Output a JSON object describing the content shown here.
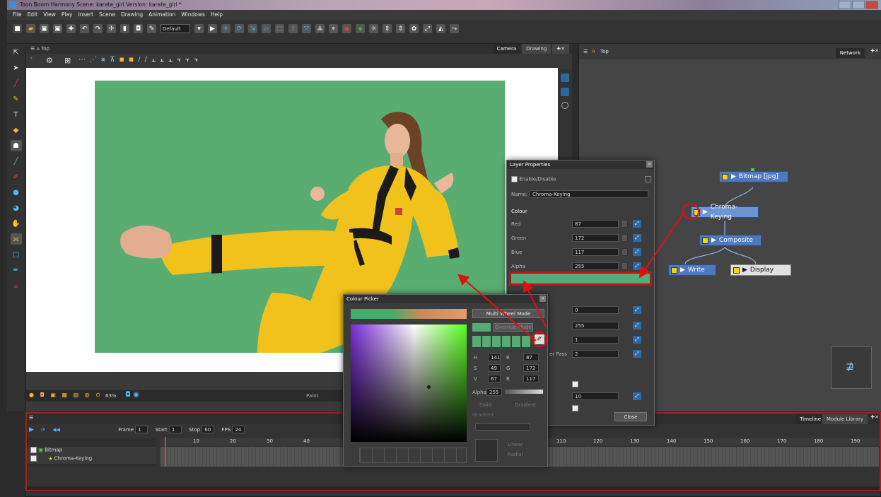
{
  "window": {
    "title": "Toon Boom Harmony Scene: karate_girl Version: karate_girl *"
  },
  "menu": [
    "File",
    "Edit",
    "View",
    "Play",
    "Insert",
    "Scene",
    "Drawing",
    "Animation",
    "Windows",
    "Help"
  ],
  "toolbar": {
    "preset_select": "Default"
  },
  "camera_view": {
    "header": "Top",
    "tabs": [
      "Camera",
      "Drawing"
    ],
    "bottom_zoom": "63%",
    "bottom_label": "Paint"
  },
  "node_view": {
    "header": "Top",
    "tab": "Network",
    "nodes": [
      {
        "label": "Bitmap [jpg]"
      },
      {
        "label": "Chroma-Keying"
      },
      {
        "label": "Composite"
      },
      {
        "label": "Write"
      },
      {
        "label": "Display"
      }
    ]
  },
  "layer_properties": {
    "title": "Layer Properties",
    "enable_label": "Enable/Disable",
    "name_label": "Name:",
    "name_value": "Chroma-Keying",
    "colour_section": "Colour",
    "red_label": "Red",
    "red_value": "87",
    "green_label": "Green",
    "green_value": "172",
    "blue_label": "Blue",
    "blue_value": "117",
    "alpha_label": "Alpha",
    "alpha_value": "255",
    "swatch_color": "#57ac75",
    "field_a": "0",
    "field_b": "255",
    "field_c": "1",
    "filter_pass_label": "er Pass",
    "field_d": "2",
    "field_e": "10",
    "close_label": "Close"
  },
  "colour_picker": {
    "title": "Colour Picker",
    "multi_wheel_mode": "Multi Wheel Mode",
    "override_label": "Override Mode",
    "h_label": "H",
    "h_value": "141",
    "s_label": "S",
    "s_value": "49",
    "v_label": "V",
    "v_value": "67",
    "r_label": "R",
    "r_value": "87",
    "g_label": "G",
    "g_value": "172",
    "b_label": "B",
    "b_value": "117",
    "alpha_label": "Alpha",
    "alpha_value": "255",
    "solid_label": "Solid",
    "gradient_label": "Gradient",
    "gradient_sub": "Gradient",
    "linear_label": "Linear",
    "radial_label": "Radial"
  },
  "timeline": {
    "frame_label": "Frame",
    "frame_value": "1",
    "start_label": "Start",
    "start_value": "1",
    "stop_label": "Stop",
    "stop_value": "60",
    "fps_label": "FPS",
    "fps_value": "24",
    "layers": [
      {
        "name": "Bitmap"
      },
      {
        "name": "Chroma-Keying"
      }
    ],
    "ruler": [
      "10",
      "20",
      "30",
      "40",
      "110",
      "120",
      "130",
      "140",
      "150",
      "160",
      "170",
      "180",
      "190"
    ],
    "tabs": [
      "Timeline",
      "Module Library"
    ]
  }
}
